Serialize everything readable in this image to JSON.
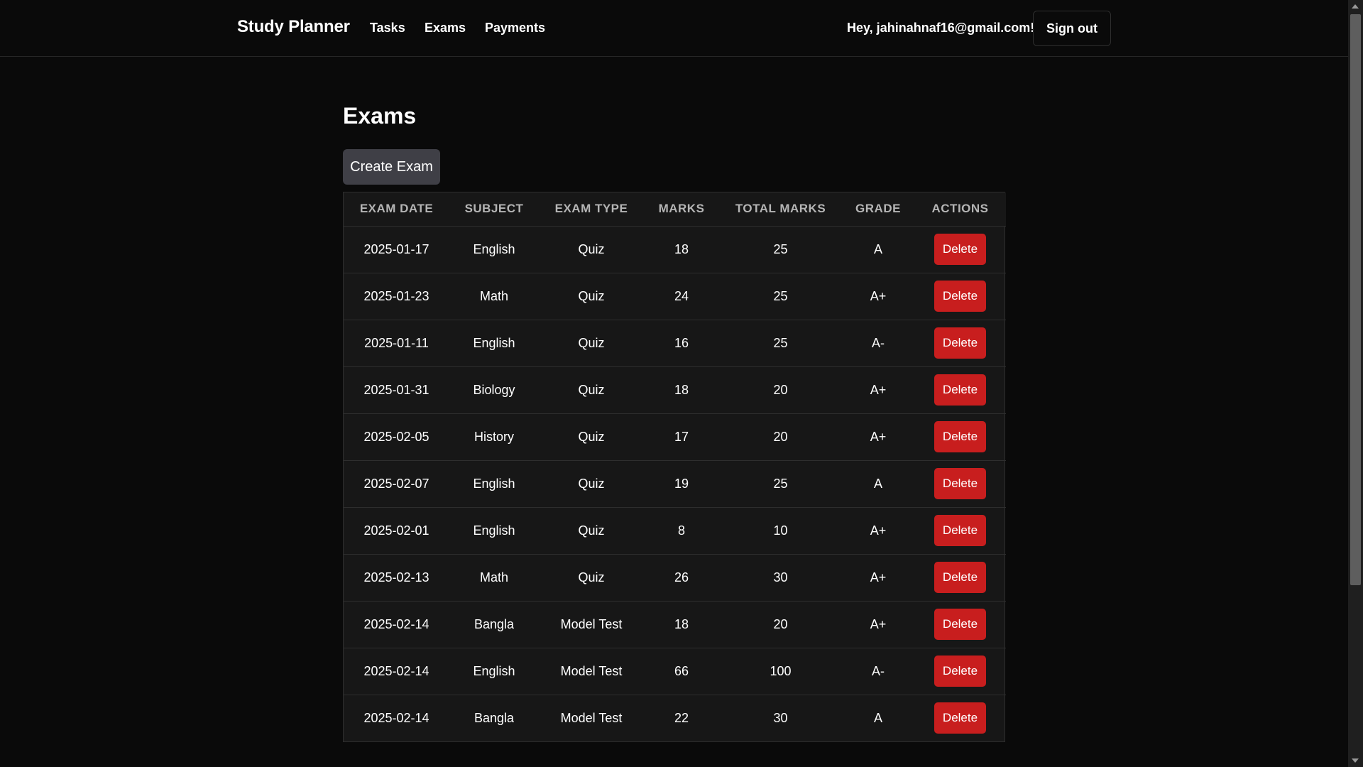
{
  "navbar": {
    "brand": "Study Planner",
    "links": [
      "Tasks",
      "Exams",
      "Payments"
    ],
    "greeting": "Hey, jahinahnaf16@gmail.com!",
    "signout_label": "Sign out"
  },
  "main": {
    "title": "Exams",
    "create_label": "Create Exam"
  },
  "table": {
    "headers": [
      "Exam Date",
      "Subject",
      "Exam Type",
      "Marks",
      "Total Marks",
      "Grade",
      "Actions"
    ],
    "delete_label": "Delete",
    "rows": [
      {
        "date": "2025-01-17",
        "subject": "English",
        "type": "Quiz",
        "marks": "18",
        "total": "25",
        "grade": "A"
      },
      {
        "date": "2025-01-23",
        "subject": "Math",
        "type": "Quiz",
        "marks": "24",
        "total": "25",
        "grade": "A+"
      },
      {
        "date": "2025-01-11",
        "subject": "English",
        "type": "Quiz",
        "marks": "16",
        "total": "25",
        "grade": "A-"
      },
      {
        "date": "2025-01-31",
        "subject": "Biology",
        "type": "Quiz",
        "marks": "18",
        "total": "20",
        "grade": "A+"
      },
      {
        "date": "2025-02-05",
        "subject": "History",
        "type": "Quiz",
        "marks": "17",
        "total": "20",
        "grade": "A+"
      },
      {
        "date": "2025-02-07",
        "subject": "English",
        "type": "Quiz",
        "marks": "19",
        "total": "25",
        "grade": "A"
      },
      {
        "date": "2025-02-01",
        "subject": "English",
        "type": "Quiz",
        "marks": "8",
        "total": "10",
        "grade": "A+"
      },
      {
        "date": "2025-02-13",
        "subject": "Math",
        "type": "Quiz",
        "marks": "26",
        "total": "30",
        "grade": "A+"
      },
      {
        "date": "2025-02-14",
        "subject": "Bangla",
        "type": "Model Test",
        "marks": "18",
        "total": "20",
        "grade": "A+"
      },
      {
        "date": "2025-02-14",
        "subject": "English",
        "type": "Model Test",
        "marks": "66",
        "total": "100",
        "grade": "A-"
      },
      {
        "date": "2025-02-14",
        "subject": "Bangla",
        "type": "Model Test",
        "marks": "22",
        "total": "30",
        "grade": "A"
      }
    ]
  },
  "colors": {
    "background": "#0a0a0a",
    "table_bg": "#171717",
    "delete": "#c81e1e",
    "create": "#3f3f46"
  }
}
